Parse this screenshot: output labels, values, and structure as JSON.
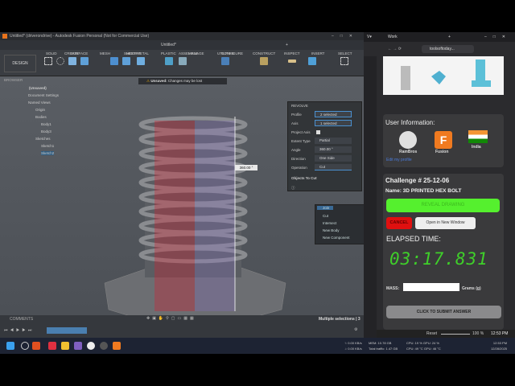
{
  "fusion": {
    "title": "Untitled* (driverondrive) - Autodesk Fusion Personal (Not for Commercial Use)",
    "doc_tab": "Untitled*",
    "workspace": "DESIGN",
    "toolbar_tabs": [
      "SOLID",
      "SURFACE",
      "MESH",
      "SHEET METAL",
      "PLASTIC",
      "MANAGE",
      "UTILITIES"
    ],
    "groups": [
      "CREATE",
      "MODIFY",
      "ASSEMBLE",
      "CONFIGURE",
      "CONSTRUCT",
      "INSPECT",
      "INSERT",
      "SELECT"
    ],
    "unsaved_label": "Unsaved:",
    "unsaved_msg": "Changes may be lost",
    "browser": {
      "title": "BROWSER",
      "items": [
        "(Unsaved)",
        "Document Settings",
        "Named Views",
        "Origin",
        "Bodies",
        "Body1",
        "Body3",
        "Sketches",
        "Sketch1",
        "Sketch2"
      ]
    },
    "dimension": "360.00 °",
    "revolve": {
      "title": "REVOLVE",
      "rows": [
        {
          "label": "Profile",
          "value": "2 selected"
        },
        {
          "label": "Axis",
          "value": "1 selected"
        },
        {
          "label": "Project Axis",
          "value": ""
        },
        {
          "label": "Extent Type",
          "value": "Partial"
        },
        {
          "label": "Angle",
          "value": "360.00 °"
        },
        {
          "label": "Direction",
          "value": "One Side"
        },
        {
          "label": "Operation",
          "value": "Cut"
        }
      ],
      "objects_to_cut": "Objects To Cut",
      "options": [
        "Join",
        "Cut",
        "Intersect",
        "New Body",
        "New Component"
      ]
    },
    "comments": "COMMENTS",
    "status": "Multiple selections | 3"
  },
  "vivaldi": {
    "workspace": "Work",
    "url": "toolsoftoday...",
    "user_info_title": "User Information:",
    "user": {
      "name": "RamBros",
      "software": "Fusion",
      "country": "India",
      "edit": "Edit my profile"
    },
    "challenge": "Challenge # 25-12-06",
    "name": "Name: 3D PRINTED HEX BOLT",
    "reveal": "REVEAL DRAWING",
    "cancel": "CANCEL",
    "open_new": "Open in New Window",
    "elapsed_label": "ELAPSED TIME:",
    "timer": "03:17.831",
    "mass_label": "MASS:",
    "mass_value": "",
    "mass_unit": "Grams (g)",
    "submit": "CLICK TO SUBMIT ANSWER",
    "reset": "Reset",
    "zoom": "100 %",
    "clock": "12:53 PM",
    "colors": {
      "green": "#55f02e",
      "red": "#e01010",
      "timer": "#3fcf2a"
    }
  },
  "taskbar": {
    "net_up": "↑: 0.00 KB/s",
    "net_down": "↓: 0.00 KB/s",
    "mem": "MEM: 10.78 GB",
    "traffic": "Total traffic: 1.47 GB",
    "cpu": "CPU: 19 %",
    "gpu": "GPU: 24 %",
    "cpu_t": "CPU: 49 °C",
    "gpu_t": "GPU: 46 °C",
    "time": "12:53 PM",
    "date": "12/28/2025"
  }
}
